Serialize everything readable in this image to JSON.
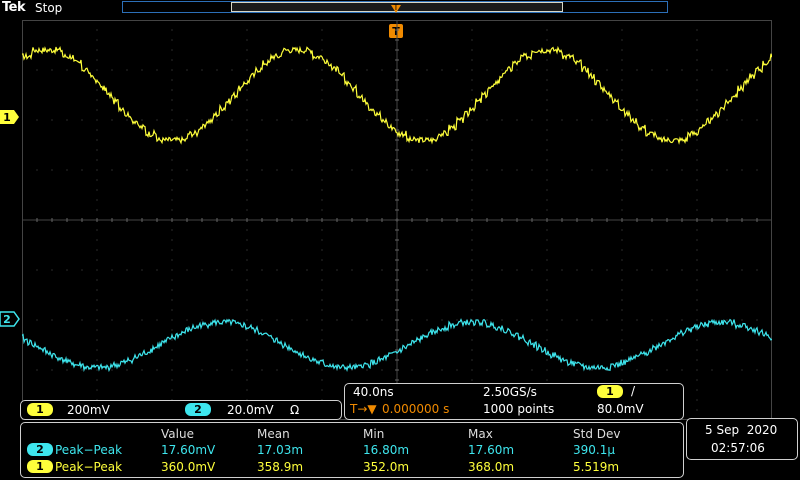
{
  "header": {
    "brand": "Tek",
    "run_state": "Stop",
    "trigger_position_marker": "T"
  },
  "channels": {
    "ch1": {
      "label": "1",
      "scale": "200mV",
      "color": "#ffff3b"
    },
    "ch2": {
      "label": "2",
      "scale": "20.0mV",
      "coupling_symbol": "Ω",
      "color": "#3ee6ee"
    }
  },
  "timebase": {
    "horizontal_scale": "40.0ns",
    "sample_rate": "2.50GS/s",
    "trigger_source": "1",
    "trigger_slope_symbol": "/",
    "trigger_delay_prefix": "T→▼",
    "trigger_delay": "0.000000 s",
    "record_length": "1000 points",
    "trigger_level": "80.0mV"
  },
  "measurements": {
    "headers": [
      "Value",
      "Mean",
      "Min",
      "Max",
      "Std Dev"
    ],
    "rows": [
      {
        "channel": "2",
        "name": "Peak−Peak",
        "value": "17.60mV",
        "mean": "17.03m",
        "min": "16.80m",
        "max": "17.60m",
        "std_dev": "390.1µ"
      },
      {
        "channel": "1",
        "name": "Peak−Peak",
        "value": "360.0mV",
        "mean": "358.9m",
        "min": "352.0m",
        "max": "368.0m",
        "std_dev": "5.519m"
      }
    ]
  },
  "datetime": {
    "date": "5 Sep  2020",
    "time": "02:57:06"
  },
  "chart_data": {
    "type": "line",
    "x_divisions": 10,
    "y_divisions": 8,
    "grid": true,
    "series": [
      {
        "name": "1",
        "color": "#ffff3b",
        "description": "roughly sinusoidal staircase wave, ~3 cycles across screen",
        "center_div": 2.5,
        "amplitude_div": 0.9,
        "cycles": 3.0,
        "phase": 0.15
      },
      {
        "name": "2",
        "color": "#3ee6ee",
        "description": "small noisy sinusoidal wave, ~3 cycles across screen",
        "center_div": -2.5,
        "amplitude_div": 0.45,
        "cycles": 3.0,
        "phase": 0.45
      }
    ]
  }
}
